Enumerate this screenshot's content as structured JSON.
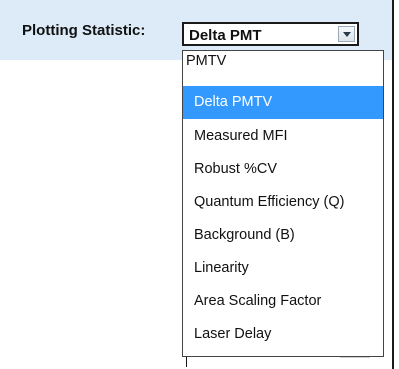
{
  "statistic_label": "Plotting Statistic:",
  "combo": {
    "value": "Delta PMT"
  },
  "dropdown": {
    "options": [
      "PMTV",
      "Delta PMTV",
      "Measured MFI",
      "Robust %CV",
      "Quantum Efficiency (Q)",
      "Background (B)",
      "Linearity",
      "Area Scaling Factor",
      "Laser Delay"
    ],
    "selected": "Delta PMTV"
  },
  "colors": {
    "header_band": "#dcebf7",
    "selection": "#3399ff"
  },
  "icons": {
    "combo_arrow": "chevron-down-icon"
  }
}
